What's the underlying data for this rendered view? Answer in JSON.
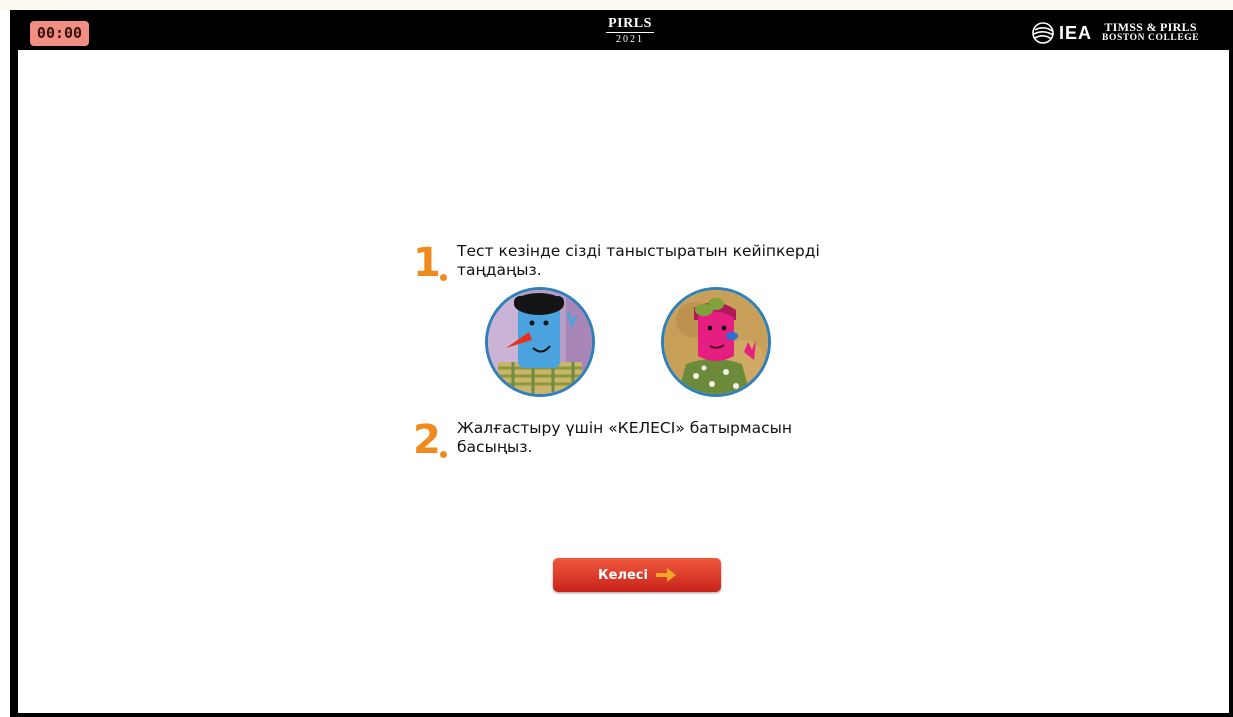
{
  "header": {
    "timer": "00:00",
    "pirls_logo": {
      "name": "PIRLS",
      "year": "2021"
    },
    "iea_logo": {
      "text": "IEA",
      "org_line1": "TIMSS & PIRLS",
      "org_line2": "BOSTON COLLEGE",
      "icon": "globe-icon"
    }
  },
  "steps": [
    {
      "number": "1",
      "text": "Тест кезінде сізді таныстыратын кейіпкерді таңдаңыз."
    },
    {
      "number": "2",
      "text": "Жалғастыру үшін «КЕЛЕСІ» батырмасын басыңыз."
    }
  ],
  "characters": [
    {
      "name": "boy-character",
      "icon": "boy-avatar-icon"
    },
    {
      "name": "girl-character",
      "icon": "girl-avatar-icon"
    }
  ],
  "next_button": {
    "label": "Келесі",
    "icon": "arrow-right-icon"
  },
  "colors": {
    "timer_bg": "#f08e84",
    "step_number": "#f08a1d",
    "avatar_border": "#2f7fb8",
    "button_top": "#f0593e",
    "button_bottom": "#c9221a",
    "arrow": "#f5a623"
  }
}
